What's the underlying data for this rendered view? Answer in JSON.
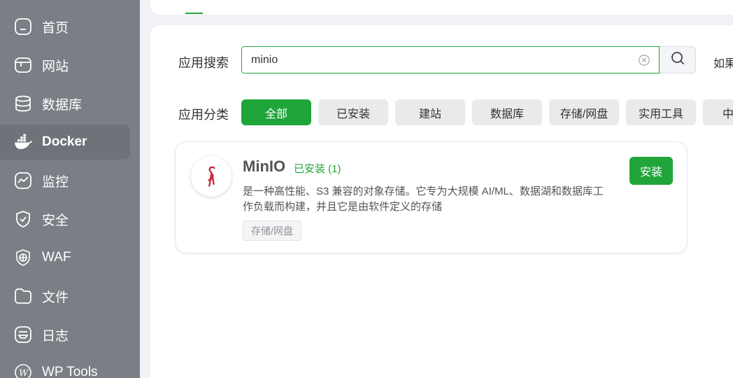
{
  "sidebar": {
    "items": [
      {
        "label": "首页",
        "icon": "home-icon"
      },
      {
        "label": "网站",
        "icon": "website-icon"
      },
      {
        "label": "数据库",
        "icon": "database-icon"
      },
      {
        "label": "Docker",
        "icon": "docker-icon",
        "active": true
      },
      {
        "label": "监控",
        "icon": "monitor-icon"
      },
      {
        "label": "安全",
        "icon": "shield-icon"
      },
      {
        "label": "WAF",
        "icon": "waf-icon"
      },
      {
        "label": "文件",
        "icon": "folder-icon"
      },
      {
        "label": "日志",
        "icon": "log-icon"
      },
      {
        "label": "WP Tools",
        "icon": "wordpress-icon"
      }
    ]
  },
  "search": {
    "label": "应用搜索",
    "value": "minio",
    "hint": "如果"
  },
  "categories": {
    "label": "应用分类",
    "items": [
      "全部",
      "已安装",
      "建站",
      "数据库",
      "存储/网盘",
      "实用工具",
      "中"
    ],
    "active_index": 0
  },
  "app": {
    "name": "MinIO",
    "installed_label": "已安装 (1)",
    "description": "是一种高性能、S3 兼容的对象存储。它专为大规模 AI/ML、数据湖和数据库工作负载而构建，并且它是由软件定义的存储",
    "category": "存储/网盘",
    "install_label": "安装"
  },
  "colors": {
    "accent": "#20a53a",
    "sidebar_bg": "#7b7e85",
    "logo_red": "#c8283c"
  }
}
